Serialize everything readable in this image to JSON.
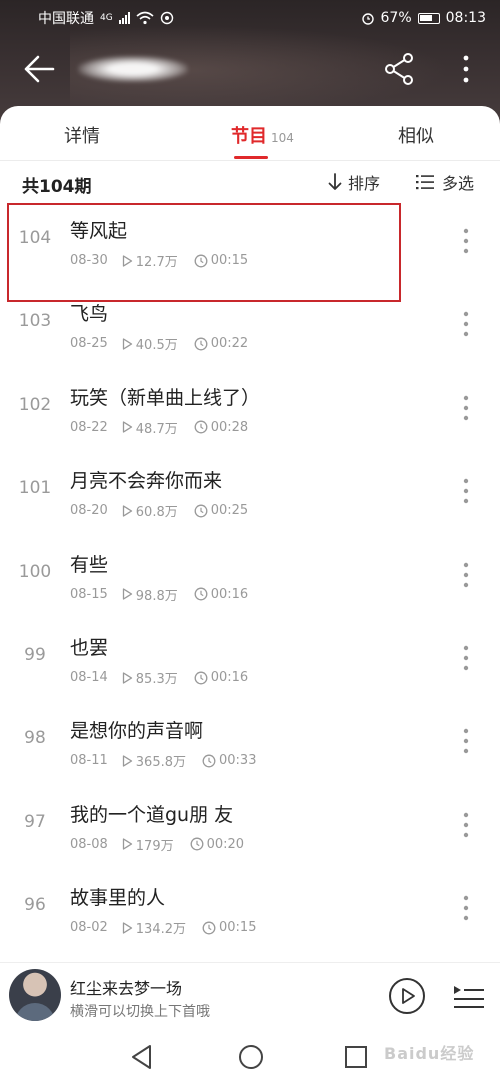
{
  "status_bar": {
    "carrier": "中国联通",
    "network": "4G",
    "battery": "67%",
    "time": "08:13"
  },
  "header": {
    "back_icon": "arrow-left-icon",
    "share_icon": "share-icon",
    "more_icon": "more-vertical-icon"
  },
  "tabs": [
    {
      "label": "详情"
    },
    {
      "label": "节目",
      "count": "104"
    },
    {
      "label": "相似"
    }
  ],
  "list_header": {
    "total": "共104期",
    "sort_label": "排序",
    "multi_select_label": "多选"
  },
  "episodes": [
    {
      "num": "104",
      "title": "等风起",
      "date": "08-30",
      "plays": "12.7万",
      "duration": "00:15"
    },
    {
      "num": "103",
      "title": "飞鸟",
      "date": "08-25",
      "plays": "40.5万",
      "duration": "00:22"
    },
    {
      "num": "102",
      "title": "玩笑（新单曲上线了）",
      "date": "08-22",
      "plays": "48.7万",
      "duration": "00:28"
    },
    {
      "num": "101",
      "title": "月亮不会奔你而来",
      "date": "08-20",
      "plays": "60.8万",
      "duration": "00:25"
    },
    {
      "num": "100",
      "title": "有些",
      "date": "08-15",
      "plays": "98.8万",
      "duration": "00:16"
    },
    {
      "num": "99",
      "title": "也罢",
      "date": "08-14",
      "plays": "85.3万",
      "duration": "00:16"
    },
    {
      "num": "98",
      "title": "是想你的声音啊",
      "date": "08-11",
      "plays": "365.8万",
      "duration": "00:33"
    },
    {
      "num": "97",
      "title": "我的一个道gu朋 友",
      "date": "08-08",
      "plays": "179万",
      "duration": "00:20"
    },
    {
      "num": "96",
      "title": "故事里的人",
      "date": "08-02",
      "plays": "134.2万",
      "duration": "00:15"
    }
  ],
  "player": {
    "title": "红尘来去梦一场",
    "subtitle": "横滑可以切换上下首哦"
  },
  "watermark": "Baidu经验",
  "colors": {
    "accent": "#e0292b",
    "highlight_box": "#c8282c"
  }
}
